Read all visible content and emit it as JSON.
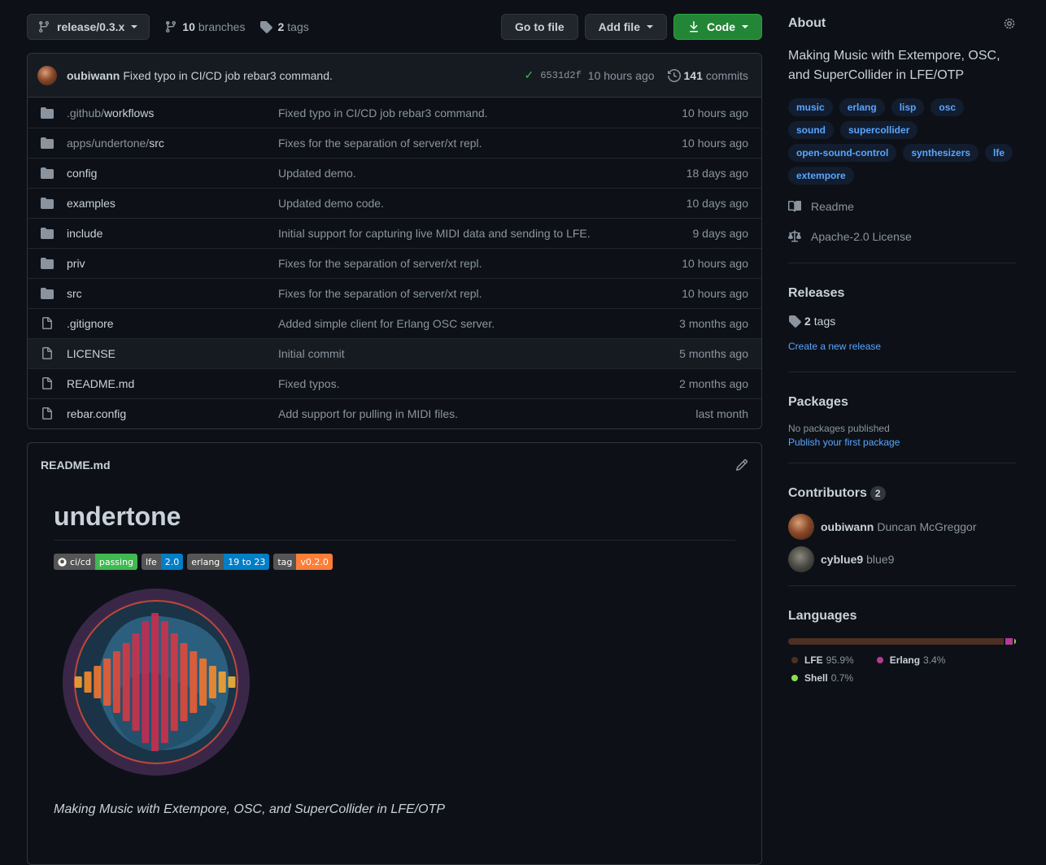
{
  "toolbar": {
    "branch": "release/0.3.x",
    "branches_count": "10",
    "branches_label": "branches",
    "tags_count": "2",
    "tags_label": "tags",
    "go_to_file": "Go to file",
    "add_file": "Add file",
    "code": "Code"
  },
  "commit": {
    "author": "oubiwann",
    "message": "Fixed typo in CI/CD job rebar3 command.",
    "sha": "6531d2f",
    "time": "10 hours ago",
    "commits_count": "141",
    "commits_label": "commits"
  },
  "files": [
    {
      "type": "dir",
      "prefix": ".github/",
      "name": "workflows",
      "message": "Fixed typo in CI/CD job rebar3 command.",
      "age": "10 hours ago"
    },
    {
      "type": "dir",
      "prefix": "apps/undertone/",
      "name": "src",
      "message": "Fixes for the separation of server/xt repl.",
      "age": "10 hours ago"
    },
    {
      "type": "dir",
      "prefix": "",
      "name": "config",
      "message": "Updated demo.",
      "age": "18 days ago"
    },
    {
      "type": "dir",
      "prefix": "",
      "name": "examples",
      "message": "Updated demo code.",
      "age": "10 days ago"
    },
    {
      "type": "dir",
      "prefix": "",
      "name": "include",
      "message": "Initial support for capturing live MIDI data and sending to LFE.",
      "age": "9 days ago"
    },
    {
      "type": "dir",
      "prefix": "",
      "name": "priv",
      "message": "Fixes for the separation of server/xt repl.",
      "age": "10 hours ago"
    },
    {
      "type": "dir",
      "prefix": "",
      "name": "src",
      "message": "Fixes for the separation of server/xt repl.",
      "age": "10 hours ago"
    },
    {
      "type": "file",
      "prefix": "",
      "name": ".gitignore",
      "message": "Added simple client for Erlang OSC server.",
      "age": "3 months ago"
    },
    {
      "type": "file",
      "prefix": "",
      "name": "LICENSE",
      "message": "Initial commit",
      "age": "5 months ago"
    },
    {
      "type": "file",
      "prefix": "",
      "name": "README.md",
      "message": "Fixed typos.",
      "age": "2 months ago"
    },
    {
      "type": "file",
      "prefix": "",
      "name": "rebar.config",
      "message": "Add support for pulling in MIDI files.",
      "age": "last month"
    }
  ],
  "readme": {
    "filename": "README.md",
    "title": "undertone",
    "badges": [
      {
        "label": "ci/cd",
        "value": "passing",
        "color": "#3fb950"
      },
      {
        "label": "lfe",
        "value": "2.0",
        "color": "#007ec6"
      },
      {
        "label": "erlang",
        "value": "19 to 23",
        "color": "#007ec6"
      },
      {
        "label": "tag",
        "value": "v0.2.0",
        "color": "#fe7d37"
      }
    ],
    "tagline": "Making Music with Extempore, OSC, and SuperCollider in LFE/OTP"
  },
  "about": {
    "heading": "About",
    "description": "Making Music with Extempore, OSC, and SuperCollider in LFE/OTP",
    "topics": [
      "music",
      "erlang",
      "lisp",
      "osc",
      "sound",
      "supercollider",
      "open-sound-control",
      "synthesizers",
      "lfe",
      "extempore"
    ],
    "readme_link": "Readme",
    "license_link": "Apache-2.0 License"
  },
  "releases": {
    "heading": "Releases",
    "tags_count": "2",
    "tags_label": "tags",
    "create_link": "Create a new release"
  },
  "packages": {
    "heading": "Packages",
    "none": "No packages published",
    "publish_link": "Publish your first package"
  },
  "contributors": {
    "heading": "Contributors",
    "count": "2",
    "people": [
      {
        "login": "oubiwann",
        "name": "Duncan McGreggor"
      },
      {
        "login": "cyblue9",
        "name": "blue9"
      }
    ]
  },
  "languages": {
    "heading": "Languages",
    "items": [
      {
        "name": "LFE",
        "percent": "95.9%",
        "value": 95.9,
        "color": "#4c3023"
      },
      {
        "name": "Erlang",
        "percent": "3.4%",
        "value": 3.4,
        "color": "#b83998"
      },
      {
        "name": "Shell",
        "percent": "0.7%",
        "value": 0.7,
        "color": "#89e051"
      }
    ]
  }
}
